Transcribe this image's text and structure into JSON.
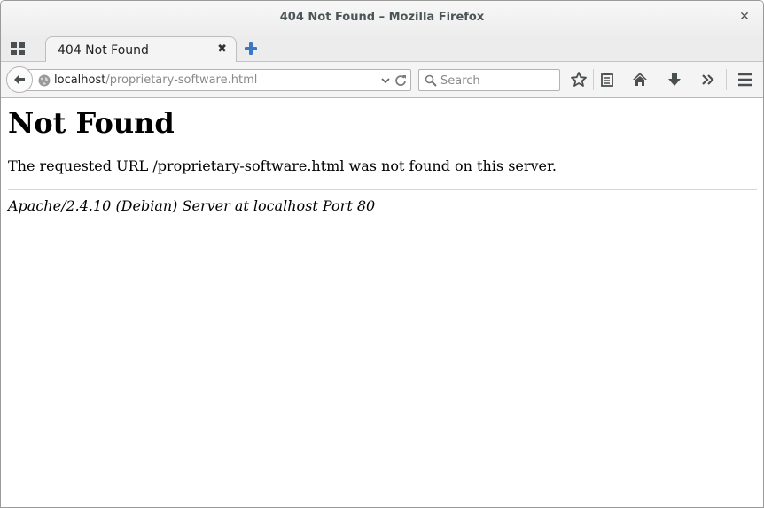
{
  "window": {
    "title": "404 Not Found – Mozilla Firefox",
    "close_icon": "close-icon"
  },
  "tabs": [
    {
      "label": "404 Not Found",
      "active": true
    }
  ],
  "navbar": {
    "url_host": "localhost",
    "url_path": "/proprietary-software.html",
    "search_placeholder": "Search",
    "search_value": "",
    "icons": [
      "back-arrow-icon",
      "globe-icon",
      "dropdown-icon",
      "reload-icon",
      "search-icon",
      "bookmark-star-icon",
      "reading-list-icon",
      "home-icon",
      "download-icon",
      "overflow-chevron-icon",
      "hamburger-menu-icon"
    ]
  },
  "page": {
    "heading": "Not Found",
    "message": "The requested URL /proprietary-software.html was not found on this server.",
    "server_signature": "Apache/2.4.10 (Debian) Server at localhost Port 80"
  },
  "colors": {
    "new_tab_accent": "#3b78c3",
    "chrome_text": "#4b5557"
  }
}
